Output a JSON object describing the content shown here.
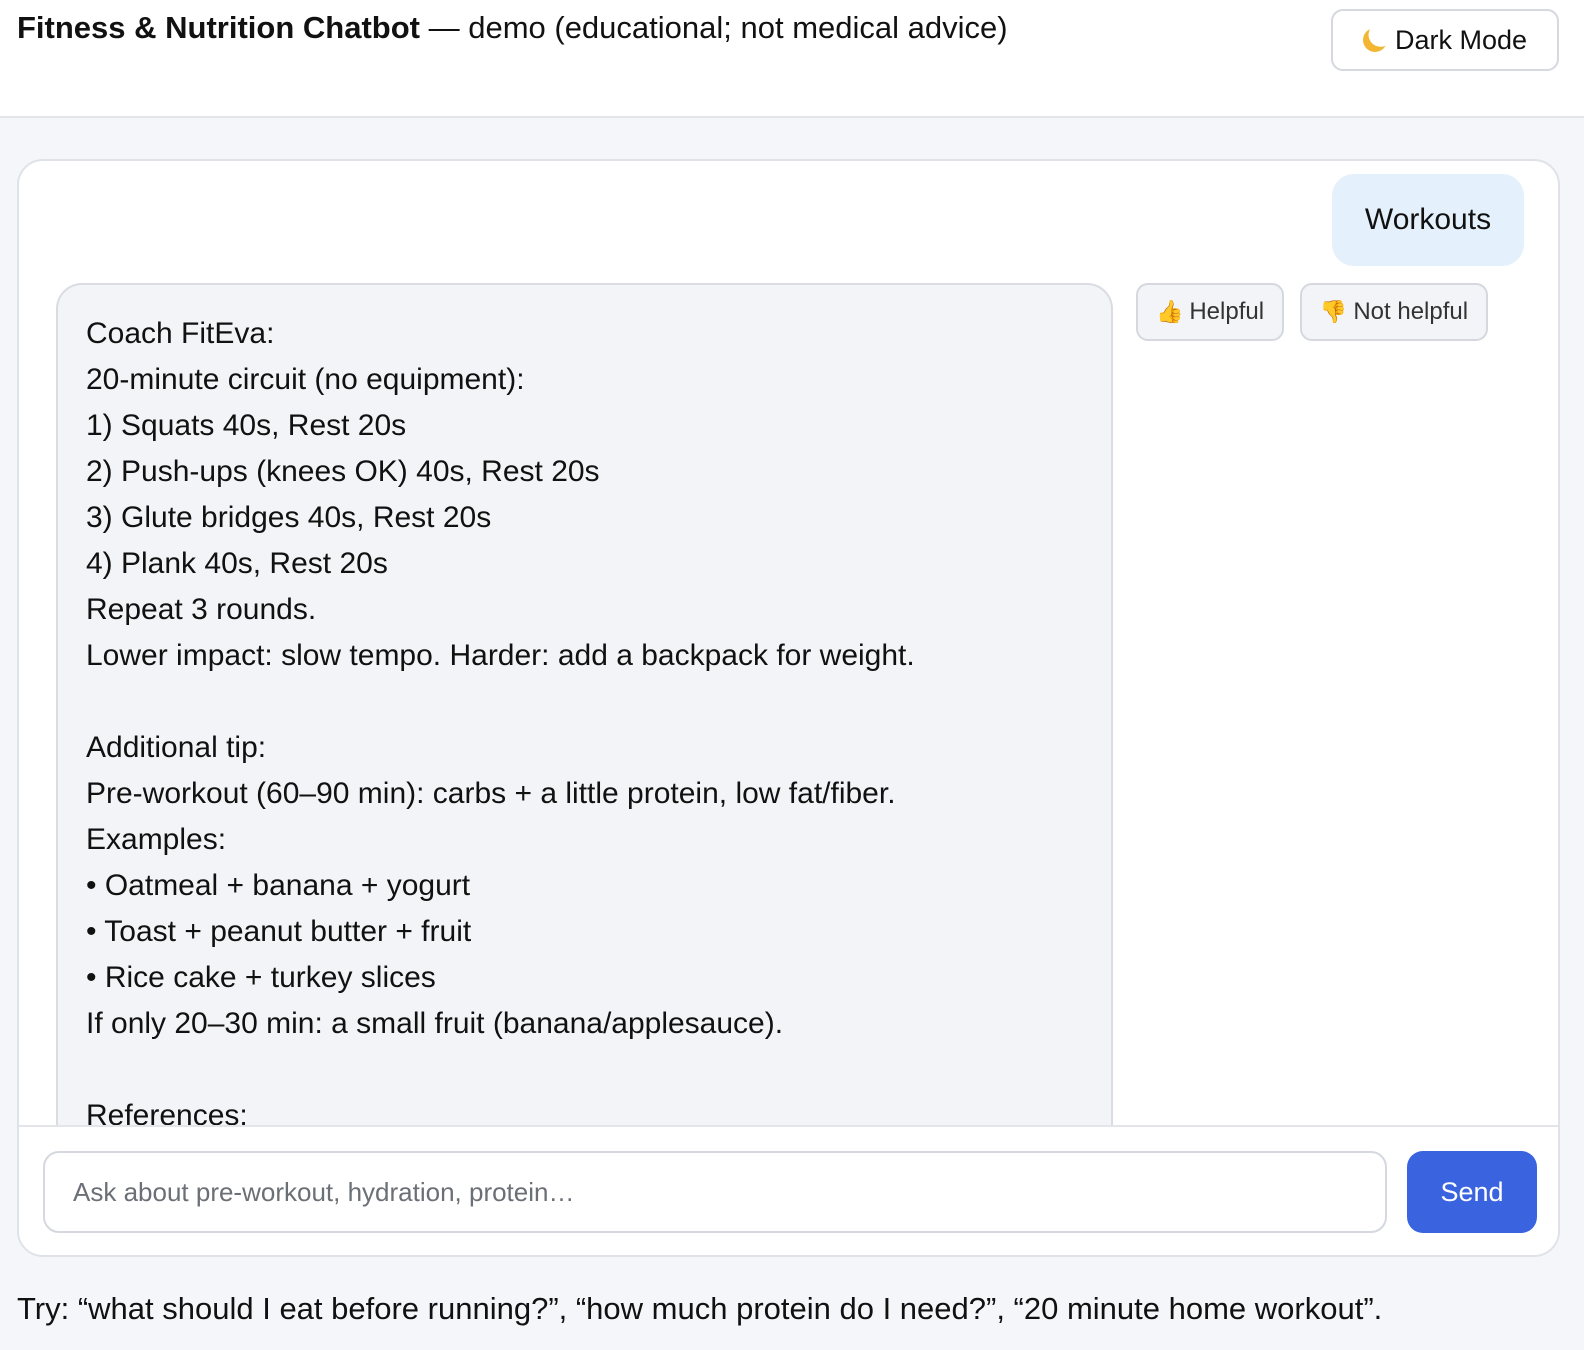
{
  "header": {
    "title_brand": "Fitness & Nutrition Chatbot",
    "title_rest": " — demo (educational; not medical advice)",
    "dark_mode_label": "Dark Mode",
    "dark_mode_icon": "moon-icon"
  },
  "chat": {
    "user_message": "Workouts",
    "bot_lines": [
      "Coach FitEva:",
      "20-minute circuit (no equipment):",
      "1) Squats 40s, Rest 20s",
      "2) Push-ups (knees OK) 40s, Rest 20s",
      "3) Glute bridges 40s, Rest 20s",
      "4) Plank 40s, Rest 20s",
      "Repeat 3 rounds.",
      "Lower impact: slow tempo. Harder: add a backpack for weight.",
      "",
      "Additional tip:",
      "Pre-workout (60–90 min): carbs + a little protein, low fat/fiber.",
      "Examples:",
      "• Oatmeal + banana + yogurt",
      "• Toast + peanut butter + fruit",
      "• Rice cake + turkey slices",
      "If only 20–30 min: a small fruit (banana/applesauce).",
      "",
      "References:"
    ],
    "feedback": {
      "helpful_label": "Helpful",
      "helpful_icon": "thumbs-up-icon",
      "not_helpful_label": "Not helpful",
      "not_helpful_icon": "thumbs-down-icon"
    }
  },
  "composer": {
    "placeholder": "Ask about pre-workout, hydration, protein…",
    "value": "",
    "send_label": "Send",
    "send_color": "#3a63e0"
  },
  "hint": "Try: “what should I eat before running?”, “how much protein do I need?”, “20 minute home workout”."
}
